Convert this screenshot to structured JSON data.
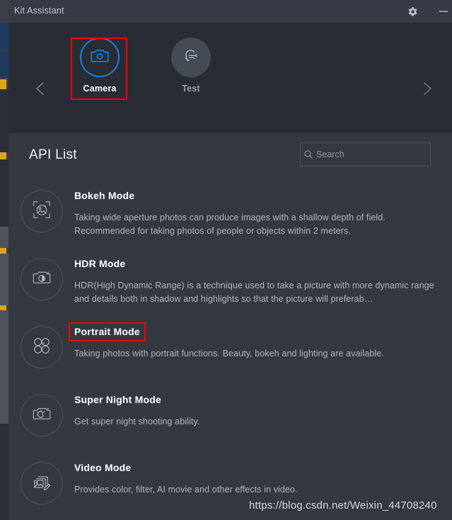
{
  "window": {
    "title": "Kit Assistant",
    "titlebar_buttons": [
      {
        "name": "settings",
        "icon": "gear-icon",
        "label": ""
      },
      {
        "name": "minimize",
        "icon": "minimize-icon",
        "label": ""
      }
    ]
  },
  "carousel": {
    "prev_arrow": "chevron-left-icon",
    "next_arrow": "chevron-right-icon",
    "selected": "Camera",
    "selection_color": "#ff0000",
    "accent_color": "#1b7fe0",
    "tiles": [
      {
        "label": "Camera",
        "icon": "camera-icon",
        "selected": true
      },
      {
        "label": "Test",
        "icon": "face-speech-icon",
        "selected": false
      }
    ]
  },
  "list": {
    "title": "API List",
    "search": {
      "value": "",
      "placeholder": "Search",
      "icon": "search-icon"
    },
    "items": [
      {
        "name": "Bokeh Mode",
        "icon": "bokeh-photo-icon",
        "description": "Taking wide aperture photos can produce images with a shallow depth of field. Recommended for taking photos of people or objects within 2 meters.",
        "highlighted": false
      },
      {
        "name": "HDR Mode",
        "icon": "hdr-camera-icon",
        "description": "HDR(High Dynamic Range) is a technique used to take a picture with more dynamic range and details both in shadow and highlights so that the picture will preferab…",
        "highlighted": false
      },
      {
        "name": "Portrait Mode",
        "icon": "flower-petals-icon",
        "description": "Taking photos with portrait functions. Beauty, bokeh and lighting are available.",
        "highlighted": true
      },
      {
        "name": "Super Night Mode",
        "icon": "night-camera-icon",
        "description": "Get super night shooting ability.",
        "highlighted": false
      },
      {
        "name": "Video Mode",
        "icon": "video-edit-icon",
        "description": "Provides color, filter, AI movie and other effects in video.",
        "highlighted": false
      }
    ]
  },
  "watermark": {
    "text": "https://blog.csdn.net/Weixin_44708240"
  }
}
